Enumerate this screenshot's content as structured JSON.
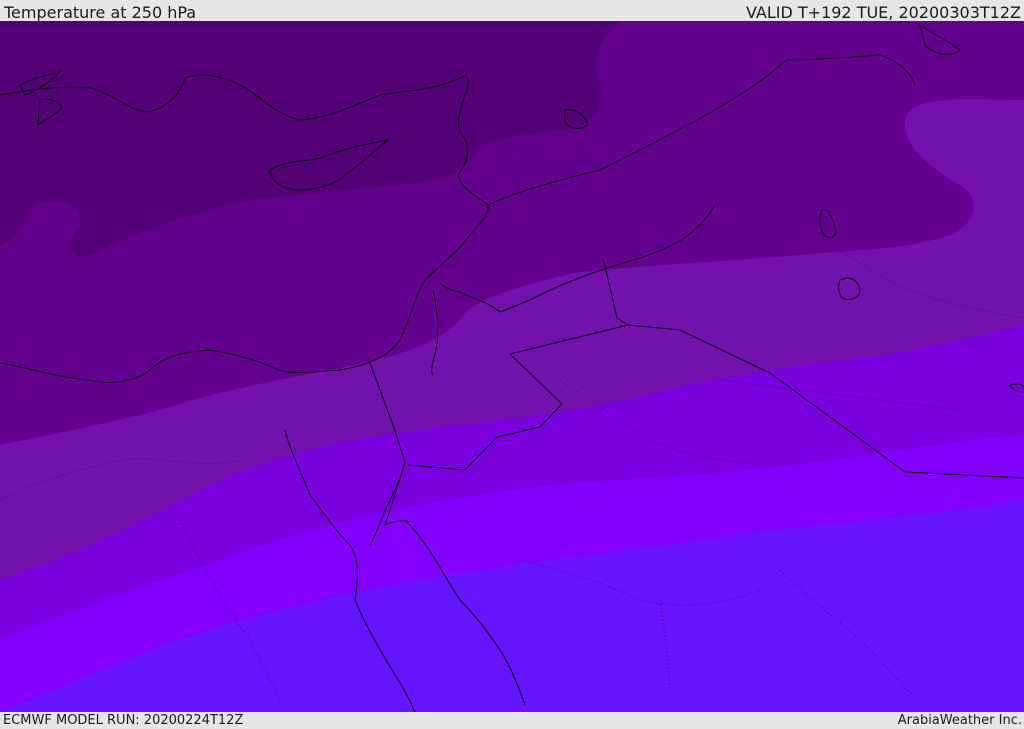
{
  "header": {
    "title": "Temperature at 250 hPa",
    "valid": "VALID T+192 TUE, 20200303T12Z"
  },
  "footer": {
    "model_run": "ECMWF MODEL RUN: 20200224T12Z",
    "credit": "ArabiaWeather Inc."
  },
  "colors": {
    "band_coldest": "#540079",
    "band_2": "#640090",
    "band_3": "#7311ad",
    "band_4": "#7a00e0",
    "band_5": "#8300ff",
    "band_warmest": "#6715ff",
    "coastline": "#000000"
  }
}
